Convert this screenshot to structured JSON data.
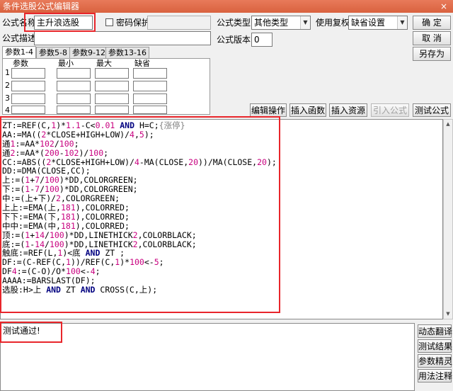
{
  "window": {
    "title": "条件选股公式编辑器",
    "close_glyph": "×"
  },
  "form": {
    "name_label": "公式名称",
    "name_value": "主升浪选股",
    "password_label": "密码保护",
    "type_label": "公式类型",
    "type_value": "其他类型",
    "rights_label": "使用复权",
    "rights_value": "缺省设置",
    "desc_label": "公式描述",
    "version_label": "公式版本",
    "version_value": "0"
  },
  "buttons": {
    "ok": "确  定",
    "cancel": "取  消",
    "save_as": "另存为",
    "edit_ops": "编辑操作",
    "insert_func": "插入函数",
    "insert_res": "插入资源",
    "import_formula": "引入公式",
    "test_formula": "测试公式",
    "dynamic_translate": "动态翻译",
    "test_result": "测试结果",
    "param_wizard": "参数精灵",
    "usage_notes": "用法注释"
  },
  "tabs": [
    "参数1-4",
    "参数5-8",
    "参数9-12",
    "参数13-16"
  ],
  "params": {
    "headers": [
      "参数",
      "最小",
      "最大",
      "缺省"
    ],
    "rows": [
      "1",
      "2",
      "3",
      "4"
    ]
  },
  "code_lines": [
    "ZT:=REF(C,1)*1.1-C<0.01 AND H=C;{涨停}",
    "AA:=MA((2*CLOSE+HIGH+LOW)/4,5);",
    "通1:=AA*102/100;",
    "通2:=AA*(200-102)/100;",
    "CC:=ABS((2*CLOSE+HIGH+LOW)/4-MA(CLOSE,20))/MA(CLOSE,20);",
    "DD:=DMA(CLOSE,CC);",
    "上:=(1+7/100)*DD,COLORGREEN;",
    "下:=(1-7/100)*DD,COLORGREEN;",
    "中:=(上+下)/2,COLORGREEN;",
    "上上:=EMA(上,181),COLORRED;",
    "下下:=EMA(下,181),COLORRED;",
    "中中:=EMA(中,181),COLORRED;",
    "顶:=(1+14/100)*DD,LINETHICK2,COLORBLACK;",
    "底:=(1-14/100)*DD,LINETHICK2,COLORBLACK;",
    "触底:=REF(L,1)<底 AND ZT ;",
    "DF:=(C-REF(C,1))/REF(C,1)*100<-5;",
    "DF4:=(C-O)/O*100<-4;",
    "AAAA:=BARSLAST(DF);",
    "选股:H>上 AND ZT AND CROSS(C,上);"
  ],
  "output_text": "测试通过!",
  "colors": {
    "titlebar": "#d9623f",
    "highlight": "#e8262b",
    "keyword": "#000080",
    "number": "#c8007f"
  }
}
